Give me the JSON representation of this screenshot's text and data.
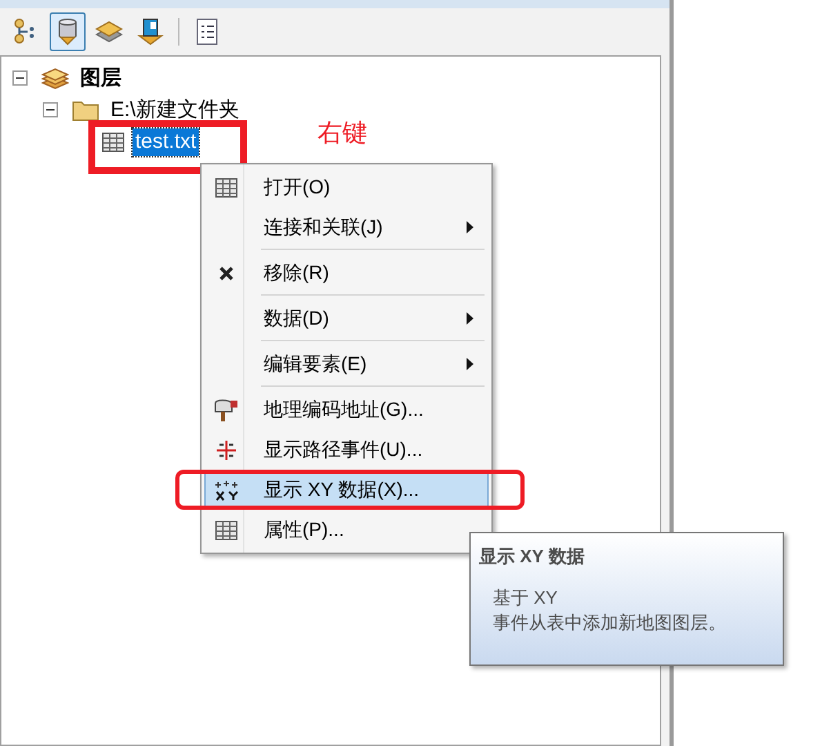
{
  "toolbar": [
    {
      "kind": "drawing-order",
      "selected": false
    },
    {
      "kind": "source",
      "selected": true
    },
    {
      "kind": "visibility",
      "selected": false
    },
    {
      "kind": "selection",
      "selected": false
    },
    {
      "kind": "options",
      "selected": false
    }
  ],
  "tree": [
    {
      "label": "图层",
      "kind": "layers",
      "expanded": true,
      "selected": false,
      "children": [
        {
          "label": "E:\\新建文件夹",
          "kind": "folder",
          "expanded": true,
          "selected": false,
          "children": [
            {
              "label": "test.txt",
              "kind": "table",
              "selected": true
            }
          ]
        }
      ]
    }
  ],
  "annotation": {
    "label": "右键"
  },
  "context_menu": [
    {
      "label": "打开(O)",
      "kind": "table",
      "submenu": false,
      "selected": false,
      "separator_after": false
    },
    {
      "label": "连接和关联(J)",
      "kind": "plain",
      "submenu": true,
      "selected": false,
      "separator_after": true
    },
    {
      "label": "移除(R)",
      "kind": "remove",
      "submenu": false,
      "selected": false,
      "separator_after": true
    },
    {
      "label": "数据(D)",
      "kind": "plain",
      "submenu": true,
      "selected": false,
      "separator_after": true
    },
    {
      "label": "编辑要素(E)",
      "kind": "plain",
      "submenu": true,
      "selected": false,
      "separator_after": true
    },
    {
      "label": "地理编码地址(G)...",
      "kind": "geocode",
      "submenu": false,
      "selected": false,
      "separator_after": false
    },
    {
      "label": "显示路径事件(U)...",
      "kind": "route",
      "submenu": false,
      "selected": false,
      "separator_after": false
    },
    {
      "label": "显示 XY 数据(X)...",
      "kind": "xy",
      "submenu": false,
      "selected": true,
      "separator_after": false
    },
    {
      "label": "属性(P)...",
      "kind": "table",
      "submenu": false,
      "selected": false,
      "separator_after": false
    }
  ],
  "tooltip": {
    "title": "显示 XY 数据",
    "body_lines": [
      "基于 XY",
      "事件从表中添加新地图图层。"
    ]
  }
}
